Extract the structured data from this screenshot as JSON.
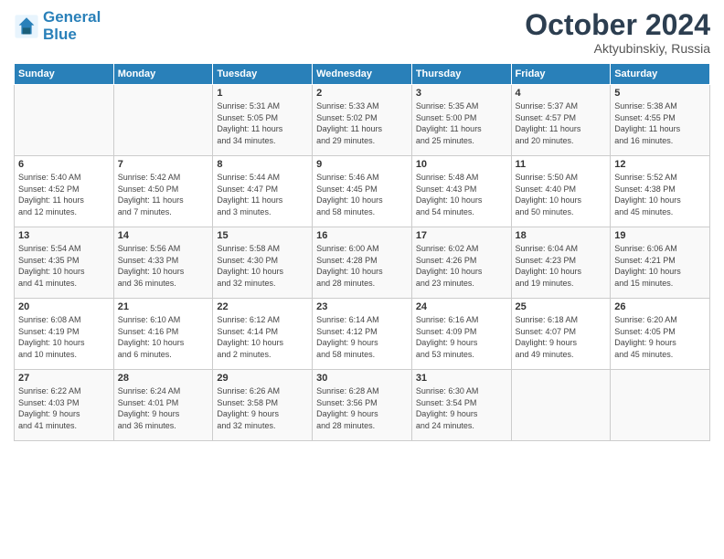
{
  "header": {
    "logo_line1": "General",
    "logo_line2": "Blue",
    "month": "October 2024",
    "location": "Aktyubinskiy, Russia"
  },
  "days_of_week": [
    "Sunday",
    "Monday",
    "Tuesday",
    "Wednesday",
    "Thursday",
    "Friday",
    "Saturday"
  ],
  "weeks": [
    [
      {
        "day": "",
        "content": ""
      },
      {
        "day": "",
        "content": ""
      },
      {
        "day": "1",
        "content": "Sunrise: 5:31 AM\nSunset: 5:05 PM\nDaylight: 11 hours\nand 34 minutes."
      },
      {
        "day": "2",
        "content": "Sunrise: 5:33 AM\nSunset: 5:02 PM\nDaylight: 11 hours\nand 29 minutes."
      },
      {
        "day": "3",
        "content": "Sunrise: 5:35 AM\nSunset: 5:00 PM\nDaylight: 11 hours\nand 25 minutes."
      },
      {
        "day": "4",
        "content": "Sunrise: 5:37 AM\nSunset: 4:57 PM\nDaylight: 11 hours\nand 20 minutes."
      },
      {
        "day": "5",
        "content": "Sunrise: 5:38 AM\nSunset: 4:55 PM\nDaylight: 11 hours\nand 16 minutes."
      }
    ],
    [
      {
        "day": "6",
        "content": "Sunrise: 5:40 AM\nSunset: 4:52 PM\nDaylight: 11 hours\nand 12 minutes."
      },
      {
        "day": "7",
        "content": "Sunrise: 5:42 AM\nSunset: 4:50 PM\nDaylight: 11 hours\nand 7 minutes."
      },
      {
        "day": "8",
        "content": "Sunrise: 5:44 AM\nSunset: 4:47 PM\nDaylight: 11 hours\nand 3 minutes."
      },
      {
        "day": "9",
        "content": "Sunrise: 5:46 AM\nSunset: 4:45 PM\nDaylight: 10 hours\nand 58 minutes."
      },
      {
        "day": "10",
        "content": "Sunrise: 5:48 AM\nSunset: 4:43 PM\nDaylight: 10 hours\nand 54 minutes."
      },
      {
        "day": "11",
        "content": "Sunrise: 5:50 AM\nSunset: 4:40 PM\nDaylight: 10 hours\nand 50 minutes."
      },
      {
        "day": "12",
        "content": "Sunrise: 5:52 AM\nSunset: 4:38 PM\nDaylight: 10 hours\nand 45 minutes."
      }
    ],
    [
      {
        "day": "13",
        "content": "Sunrise: 5:54 AM\nSunset: 4:35 PM\nDaylight: 10 hours\nand 41 minutes."
      },
      {
        "day": "14",
        "content": "Sunrise: 5:56 AM\nSunset: 4:33 PM\nDaylight: 10 hours\nand 36 minutes."
      },
      {
        "day": "15",
        "content": "Sunrise: 5:58 AM\nSunset: 4:30 PM\nDaylight: 10 hours\nand 32 minutes."
      },
      {
        "day": "16",
        "content": "Sunrise: 6:00 AM\nSunset: 4:28 PM\nDaylight: 10 hours\nand 28 minutes."
      },
      {
        "day": "17",
        "content": "Sunrise: 6:02 AM\nSunset: 4:26 PM\nDaylight: 10 hours\nand 23 minutes."
      },
      {
        "day": "18",
        "content": "Sunrise: 6:04 AM\nSunset: 4:23 PM\nDaylight: 10 hours\nand 19 minutes."
      },
      {
        "day": "19",
        "content": "Sunrise: 6:06 AM\nSunset: 4:21 PM\nDaylight: 10 hours\nand 15 minutes."
      }
    ],
    [
      {
        "day": "20",
        "content": "Sunrise: 6:08 AM\nSunset: 4:19 PM\nDaylight: 10 hours\nand 10 minutes."
      },
      {
        "day": "21",
        "content": "Sunrise: 6:10 AM\nSunset: 4:16 PM\nDaylight: 10 hours\nand 6 minutes."
      },
      {
        "day": "22",
        "content": "Sunrise: 6:12 AM\nSunset: 4:14 PM\nDaylight: 10 hours\nand 2 minutes."
      },
      {
        "day": "23",
        "content": "Sunrise: 6:14 AM\nSunset: 4:12 PM\nDaylight: 9 hours\nand 58 minutes."
      },
      {
        "day": "24",
        "content": "Sunrise: 6:16 AM\nSunset: 4:09 PM\nDaylight: 9 hours\nand 53 minutes."
      },
      {
        "day": "25",
        "content": "Sunrise: 6:18 AM\nSunset: 4:07 PM\nDaylight: 9 hours\nand 49 minutes."
      },
      {
        "day": "26",
        "content": "Sunrise: 6:20 AM\nSunset: 4:05 PM\nDaylight: 9 hours\nand 45 minutes."
      }
    ],
    [
      {
        "day": "27",
        "content": "Sunrise: 6:22 AM\nSunset: 4:03 PM\nDaylight: 9 hours\nand 41 minutes."
      },
      {
        "day": "28",
        "content": "Sunrise: 6:24 AM\nSunset: 4:01 PM\nDaylight: 9 hours\nand 36 minutes."
      },
      {
        "day": "29",
        "content": "Sunrise: 6:26 AM\nSunset: 3:58 PM\nDaylight: 9 hours\nand 32 minutes."
      },
      {
        "day": "30",
        "content": "Sunrise: 6:28 AM\nSunset: 3:56 PM\nDaylight: 9 hours\nand 28 minutes."
      },
      {
        "day": "31",
        "content": "Sunrise: 6:30 AM\nSunset: 3:54 PM\nDaylight: 9 hours\nand 24 minutes."
      },
      {
        "day": "",
        "content": ""
      },
      {
        "day": "",
        "content": ""
      }
    ]
  ]
}
